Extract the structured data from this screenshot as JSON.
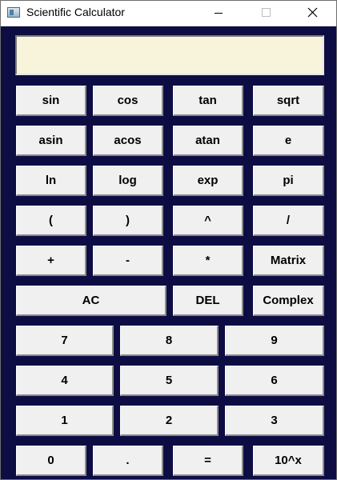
{
  "window": {
    "title": "Scientific Calculator",
    "icon": "calculator-app-icon",
    "controls": [
      "minimize-icon",
      "maximize-icon",
      "close-icon"
    ]
  },
  "display": {
    "value": ""
  },
  "keys": {
    "sin": "sin",
    "cos": "cos",
    "tan": "tan",
    "sqrt": "sqrt",
    "asin": "asin",
    "acos": "acos",
    "atan": "atan",
    "e": "e",
    "ln": "ln",
    "log": "log",
    "exp": "exp",
    "pi": "pi",
    "lparen": "(",
    "rparen": ")",
    "caret": "^",
    "slash": "/",
    "plus": "+",
    "minus": "-",
    "star": "*",
    "matrix": "Matrix",
    "ac": "AC",
    "del": "DEL",
    "complex": "Complex",
    "d7": "7",
    "d8": "8",
    "d9": "9",
    "d4": "4",
    "d5": "5",
    "d6": "6",
    "d1": "1",
    "d2": "2",
    "d3": "3",
    "d0": "0",
    "dot": ".",
    "equals": "=",
    "pow10": "10^x"
  },
  "colors": {
    "window_background": "#0d0d44",
    "display_background": "#f8f4dc",
    "key_face": "#f0f0f0"
  }
}
